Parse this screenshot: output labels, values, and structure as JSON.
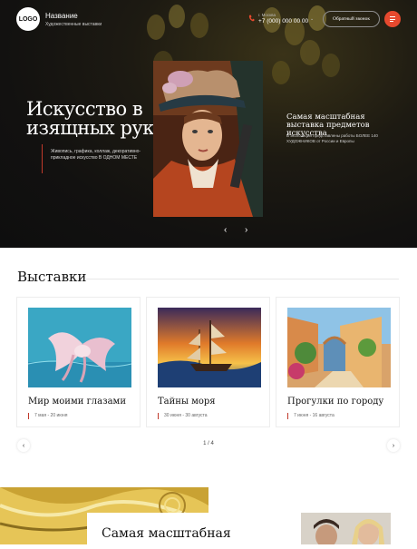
{
  "header": {
    "logo": "LOGO",
    "brand_name": "Название",
    "brand_sub": "Художественные выставки",
    "city": "г. Москва",
    "phone": "+7 (000) 000 00 00",
    "callback_label": "Обратный звонок",
    "menu_icon": "menu-icon",
    "accent_color": "#e6492e"
  },
  "hero": {
    "title_line1": "Искусство в",
    "title_line2": "изящных руках",
    "description": "Живопись, графика, коллаж, декоративно-прикладное искусство В ОДНОМ МЕСТЕ",
    "side_title": "Самая масштабная выставка предметов искусства",
    "side_desc": "В экспозиции представлены работы БОЛЕЕ 140 ХУДОЖНИКОВ от России и Европы",
    "prev_icon": "‹",
    "next_icon": "›"
  },
  "exhibitions": {
    "title": "Выставки",
    "cards": [
      {
        "title": "Мир моими глазами",
        "date": "7 мая - 20 июня"
      },
      {
        "title": "Тайны моря",
        "date": "30 июня - 30 августа"
      },
      {
        "title": "Прогулки по городу",
        "date": "7 июня - 16 августа"
      }
    ],
    "pager": "1 / 4",
    "prev_icon": "‹",
    "next_icon": "›"
  },
  "bottom": {
    "title": "Самая масштабная"
  }
}
